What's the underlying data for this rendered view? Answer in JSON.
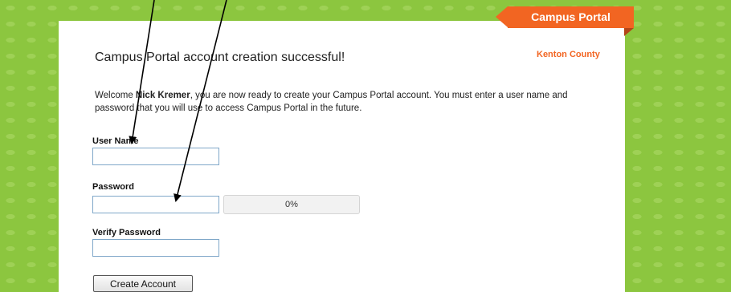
{
  "header": {
    "brand": "Campus Portal",
    "district": "Kenton County",
    "title": "Campus Portal account creation successful!"
  },
  "intro": {
    "welcome": "Welcome ",
    "user_name": "Nick Kremer",
    "message": ", you are now ready to create your Campus Portal account. You must enter a user name and password that you will use to access Campus Portal in the future."
  },
  "form": {
    "username_label": "User Name",
    "username_value": "",
    "password_label": "Password",
    "password_value": "",
    "strength_text": "0%",
    "strength_fraction": 0,
    "verify_label": "Verify Password",
    "verify_value": "",
    "submit_label": "Create Account"
  },
  "colors": {
    "background": "#8cc63f",
    "accent": "#f26522",
    "field_border": "#7fa7c9"
  }
}
